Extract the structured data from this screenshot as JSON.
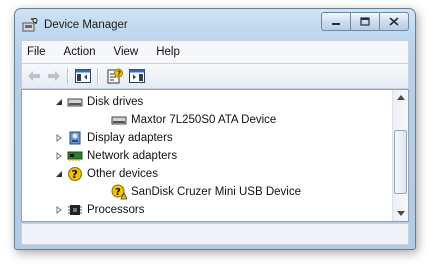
{
  "window": {
    "title": "Device Manager"
  },
  "menu": {
    "items": [
      "File",
      "Action",
      "View",
      "Help"
    ]
  },
  "tree": {
    "items": [
      {
        "label": "Disk drives",
        "expanded": true,
        "icon": "disk-drive-icon"
      },
      {
        "label": "Maxtor 7L250S0 ATA Device",
        "icon": "disk-drive-icon"
      },
      {
        "label": "Display adapters",
        "expanded": false,
        "icon": "display-adapter-icon"
      },
      {
        "label": "Network adapters",
        "expanded": false,
        "icon": "network-adapter-icon"
      },
      {
        "label": "Other devices",
        "expanded": true,
        "icon": "unknown-device-icon"
      },
      {
        "label": "SanDisk Cruzer Mini USB Device",
        "icon": "unknown-device-warning-icon"
      },
      {
        "label": "Processors",
        "expanded": false,
        "icon": "processor-icon"
      }
    ]
  },
  "toolbar": {
    "buttons": [
      "back-icon",
      "forward-icon",
      "show-hide-console-tree-icon",
      "properties-icon",
      "help-icon"
    ]
  },
  "colors": {
    "titlebar": "#bcd6ee",
    "accent": "#f2c200"
  }
}
